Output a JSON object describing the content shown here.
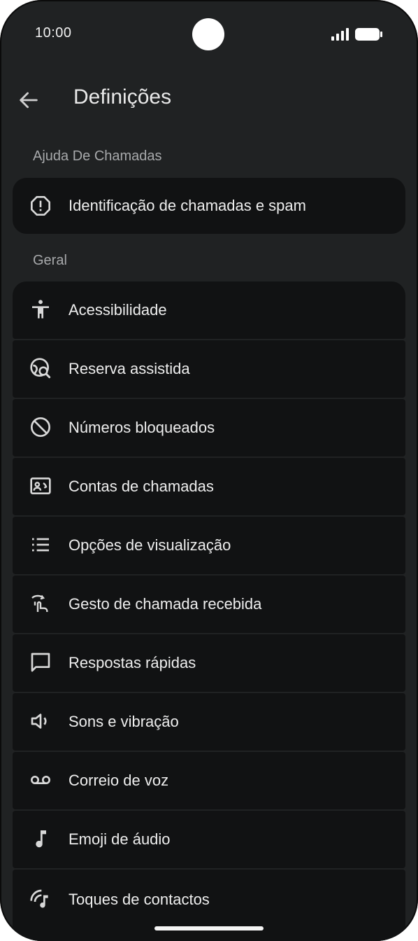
{
  "status": {
    "time": "10:00"
  },
  "appbar": {
    "title": "Definições"
  },
  "sections": {
    "call_help": "Ajuda De Chamadas",
    "general": "Geral"
  },
  "call_help_items": [
    {
      "label": "Identificação de chamadas e spam",
      "icon": "spam-alert-icon"
    }
  ],
  "general_items": [
    {
      "label": "Acessibilidade",
      "icon": "accessibility-icon"
    },
    {
      "label": "Reserva assistida",
      "icon": "assisted-booking-icon"
    },
    {
      "label": "Números bloqueados",
      "icon": "block-icon"
    },
    {
      "label": "Contas de chamadas",
      "icon": "calling-accounts-icon"
    },
    {
      "label": "Opções de visualização",
      "icon": "list-icon"
    },
    {
      "label": "Gesto de chamada recebida",
      "icon": "gesture-icon"
    },
    {
      "label": "Respostas rápidas",
      "icon": "chat-icon"
    },
    {
      "label": "Sons e vibração",
      "icon": "volume-icon"
    },
    {
      "label": "Correio de voz",
      "icon": "voicemail-icon"
    },
    {
      "label": "Emoji de áudio",
      "icon": "music-note-icon"
    },
    {
      "label": "Toques de contactos",
      "icon": "contact-ringtone-icon"
    }
  ]
}
